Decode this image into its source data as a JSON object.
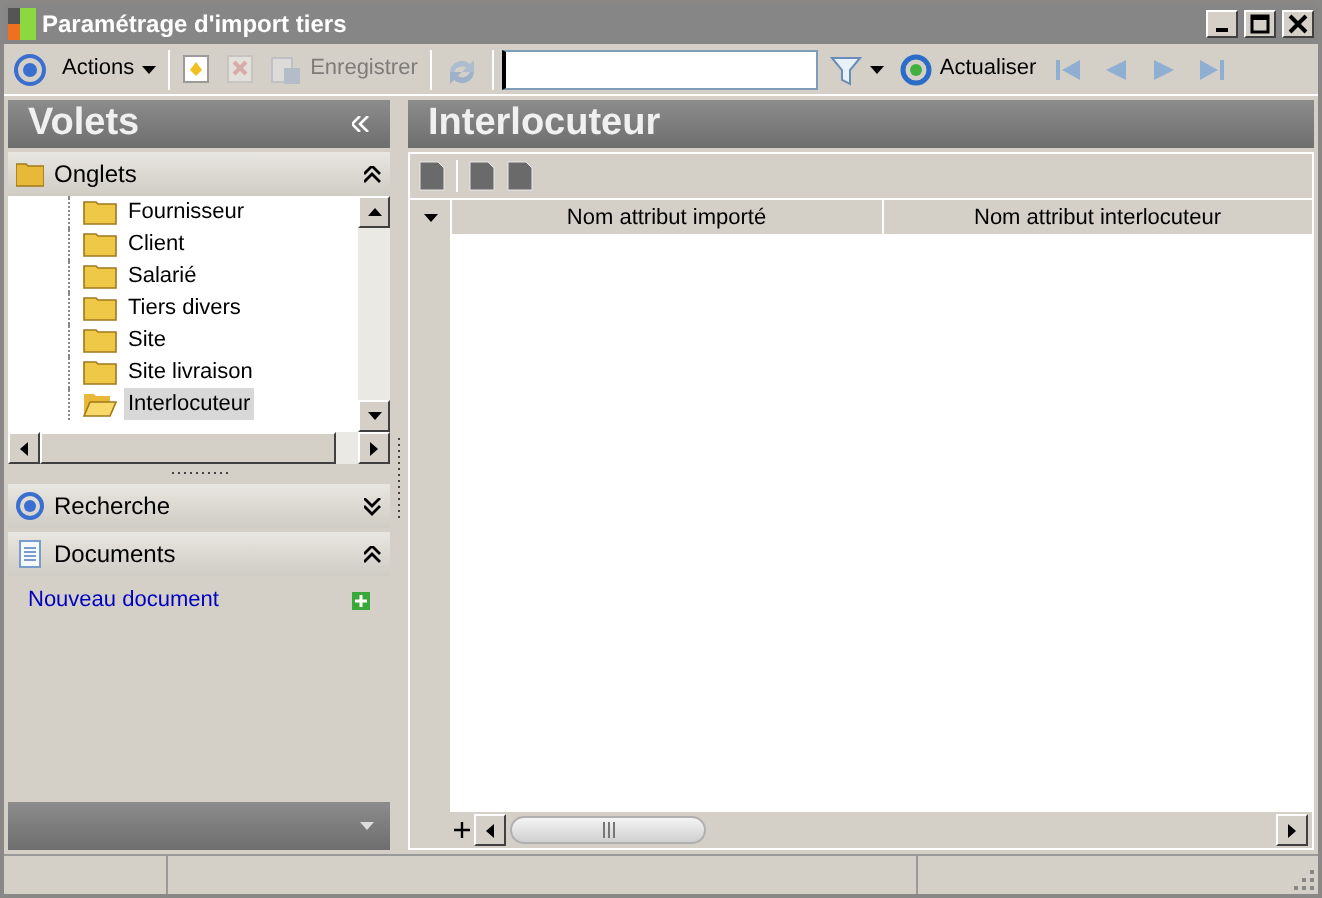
{
  "window": {
    "title": "Paramétrage d'import tiers"
  },
  "toolbar": [
    {
      "kind": "target",
      "disabled": false
    },
    {
      "kind": "menu",
      "label": "Actions",
      "disabled": false
    },
    {
      "kind": "new",
      "disabled": false
    },
    {
      "kind": "delete",
      "disabled": true
    },
    {
      "kind": "save",
      "label": "Enregistrer",
      "disabled": true
    },
    {
      "kind": "sync",
      "disabled": true
    },
    {
      "kind": "search"
    },
    {
      "kind": "filter",
      "disabled": false
    },
    {
      "kind": "refresh",
      "label": "Actualiser",
      "disabled": false
    },
    {
      "kind": "first",
      "disabled": true
    },
    {
      "kind": "prev",
      "disabled": true
    },
    {
      "kind": "next",
      "disabled": true
    },
    {
      "kind": "last",
      "disabled": true
    }
  ],
  "left_pane": {
    "title": "Volets",
    "sections": [
      {
        "kind": "tree",
        "title": "Onglets",
        "expanded": true,
        "items": [
          {
            "label": "Fournisseur",
            "selected": false
          },
          {
            "label": "Client",
            "selected": false
          },
          {
            "label": "Salarié",
            "selected": false
          },
          {
            "label": "Tiers divers",
            "selected": false
          },
          {
            "label": "Site",
            "selected": false
          },
          {
            "label": "Site livraison",
            "selected": false
          },
          {
            "label": "Interlocuteur",
            "selected": true
          }
        ]
      },
      {
        "kind": "search",
        "title": "Recherche",
        "expanded": false
      },
      {
        "kind": "documents",
        "title": "Documents",
        "expanded": true,
        "links": [
          "Nouveau document"
        ]
      }
    ]
  },
  "right_pane": {
    "title": "Interlocuteur",
    "table": {
      "columns": [
        "Nom attribut importé",
        "Nom attribut interlocuteur"
      ]
    }
  }
}
